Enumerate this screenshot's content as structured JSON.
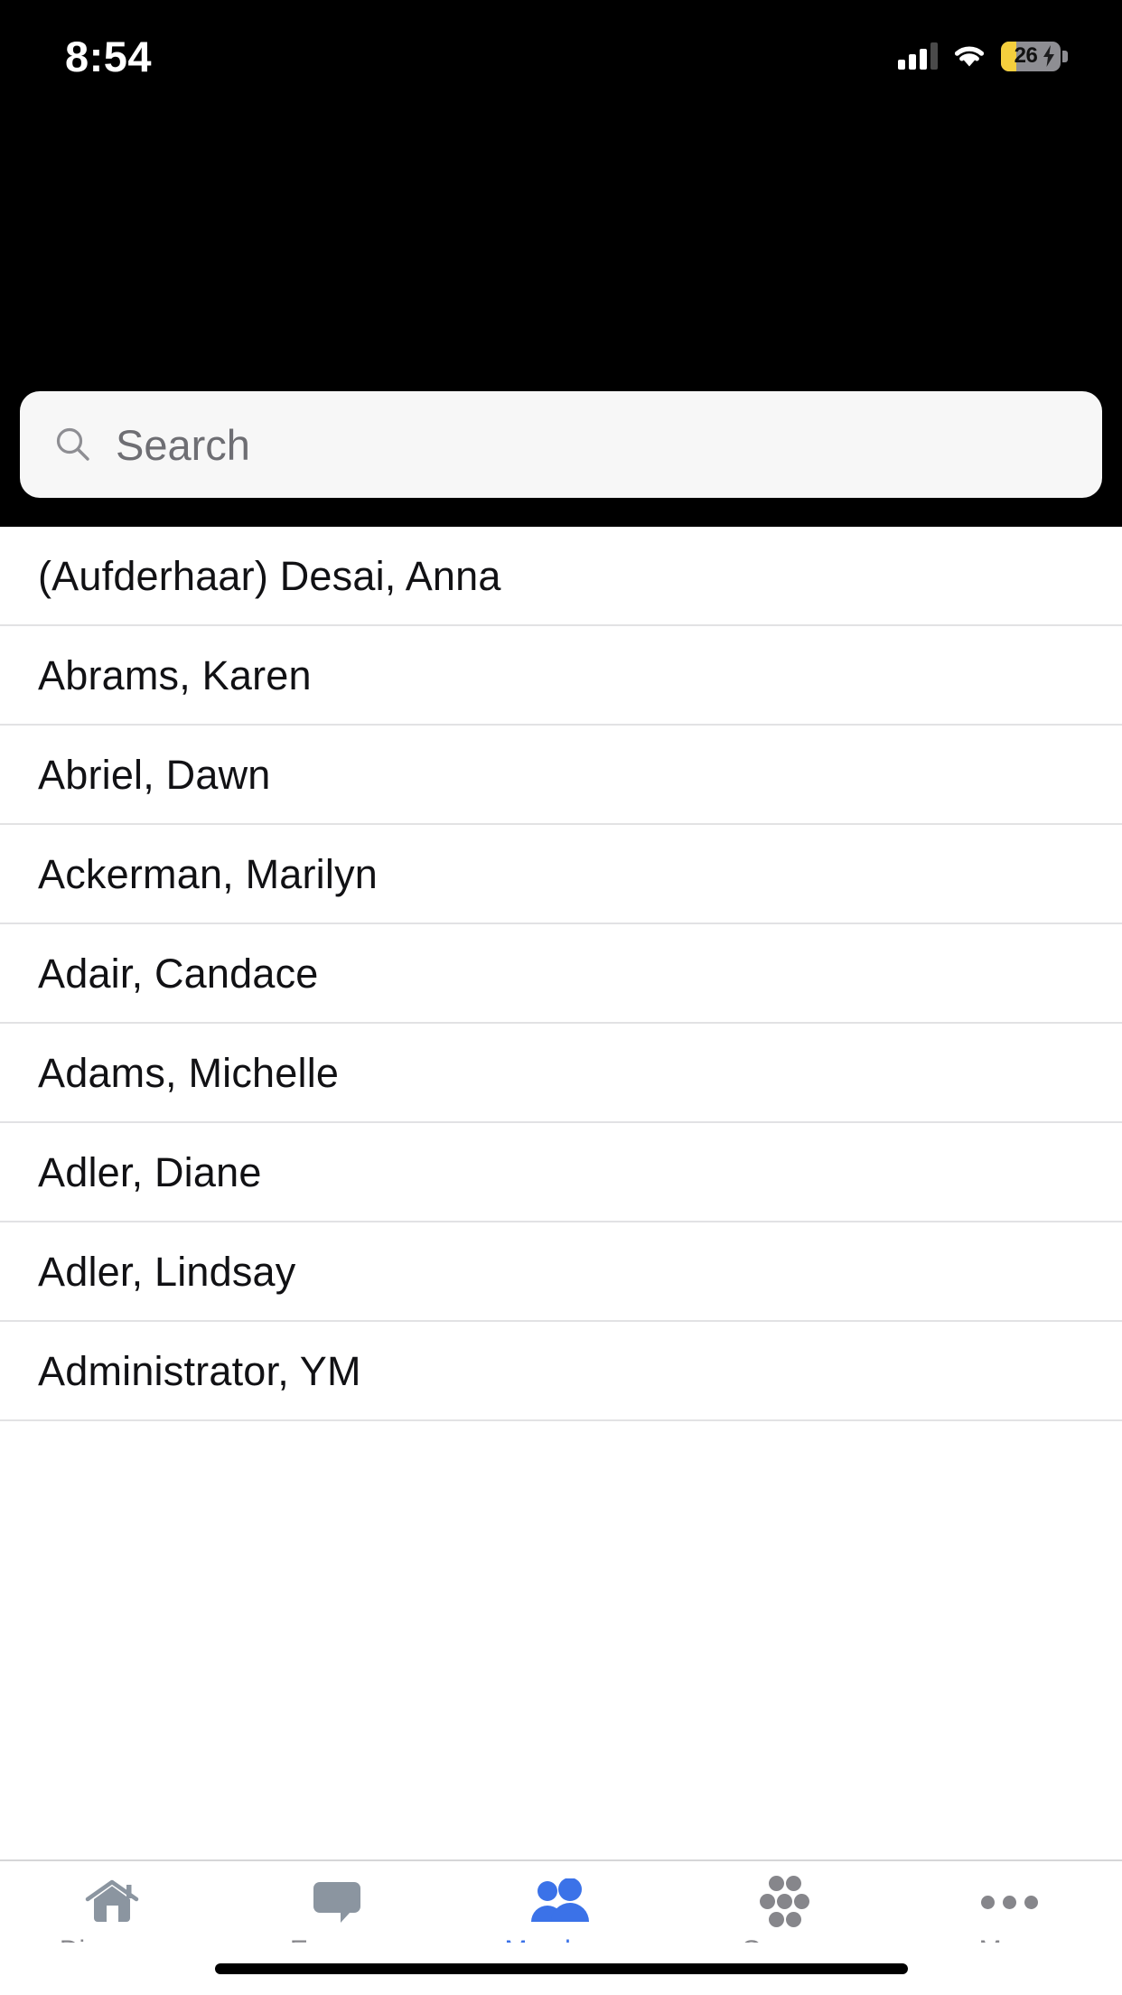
{
  "status_bar": {
    "time": "8:54",
    "signal_icon": "cellular-signal-icon",
    "wifi_icon": "wifi-icon",
    "battery_level": "26",
    "battery_icon": "battery-charging-low-power-icon"
  },
  "search": {
    "placeholder": "Search",
    "value": "",
    "icon": "search-icon"
  },
  "members_list": {
    "rows": [
      {
        "name": "(Aufderhaar) Desai, Anna"
      },
      {
        "name": "Abrams, Karen"
      },
      {
        "name": "Abriel, Dawn"
      },
      {
        "name": "Ackerman, Marilyn"
      },
      {
        "name": "Adair, Candace"
      },
      {
        "name": "Adams, Michelle"
      },
      {
        "name": "Adler, Diane"
      },
      {
        "name": "Adler, Lindsay"
      },
      {
        "name": "Administrator, YM"
      }
    ]
  },
  "tab_bar": {
    "active_index": 2,
    "tabs": [
      {
        "label": "Discover",
        "icon": "home-icon"
      },
      {
        "label": "Engage",
        "icon": "speech-bubble-icon"
      },
      {
        "label": "Members",
        "icon": "people-icon"
      },
      {
        "label": "Groups",
        "icon": "groups-dots-icon"
      },
      {
        "label": "More",
        "icon": "ellipsis-icon"
      }
    ]
  },
  "colors": {
    "accent": "#3b72e8",
    "inactive": "#86868b",
    "header_bg": "#000000",
    "search_bg": "#f7f7f7",
    "divider": "#e2e2e4",
    "low_power_yellow": "#f5cf3d"
  },
  "home_indicator": {
    "label": "home-indicator"
  }
}
